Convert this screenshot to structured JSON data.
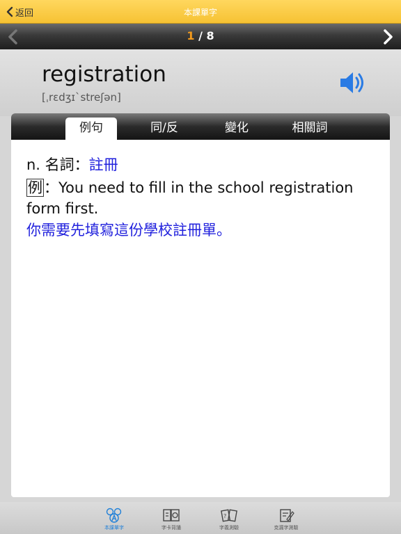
{
  "header": {
    "back_label": "返回",
    "title": "本課單字"
  },
  "pager": {
    "current": "1",
    "separator": " / ",
    "total": "8"
  },
  "word": {
    "text": "registration",
    "phonetic": "[ˌrɛdʒɪˋstreʃən]"
  },
  "tabs": [
    {
      "label": "例句",
      "active": true
    },
    {
      "label": "同/反",
      "active": false
    },
    {
      "label": "變化",
      "active": false
    },
    {
      "label": "相關詞",
      "active": false
    }
  ],
  "content": {
    "pos": "n. 名詞：",
    "meaning": "註冊",
    "example_tag": "例",
    "example_colon": "：",
    "example_en": "You need to fill in the school registration form first.",
    "example_zh": "你需要先填寫這份學校註冊單。"
  },
  "toolbar": [
    {
      "label": "本課單字",
      "icon": "word-list-icon",
      "active": true
    },
    {
      "label": "字卡背誦",
      "icon": "flashcard-icon",
      "active": false
    },
    {
      "label": "字義測驗",
      "icon": "quiz-icon",
      "active": false
    },
    {
      "label": "克漏字測驗",
      "icon": "cloze-icon",
      "active": false
    }
  ],
  "colors": {
    "topbar": "#f6c233",
    "accent_orange": "#f49b1c",
    "meaning_blue": "#2222dd",
    "toolbar_active": "#1e7fd8"
  }
}
